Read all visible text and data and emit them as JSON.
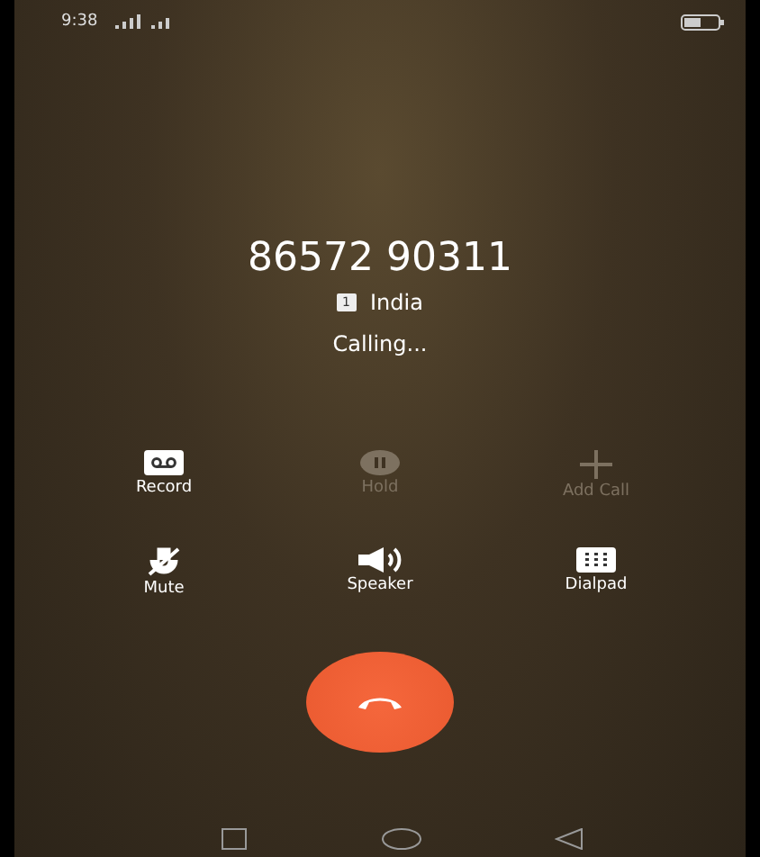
{
  "status_bar": {
    "time": "9:38"
  },
  "call": {
    "number": "86572 90311",
    "sim": "1",
    "location": "India",
    "status": "Calling..."
  },
  "controls": [
    {
      "kind": "record",
      "label": "Record",
      "disabled": false
    },
    {
      "kind": "hold",
      "label": "Hold",
      "disabled": true
    },
    {
      "kind": "add",
      "label": "Add Call",
      "disabled": true
    },
    {
      "kind": "mute",
      "label": "Mute",
      "disabled": false
    },
    {
      "kind": "speaker",
      "label": "Speaker",
      "disabled": false
    },
    {
      "kind": "dialpad",
      "label": "Dialpad",
      "disabled": false
    }
  ]
}
